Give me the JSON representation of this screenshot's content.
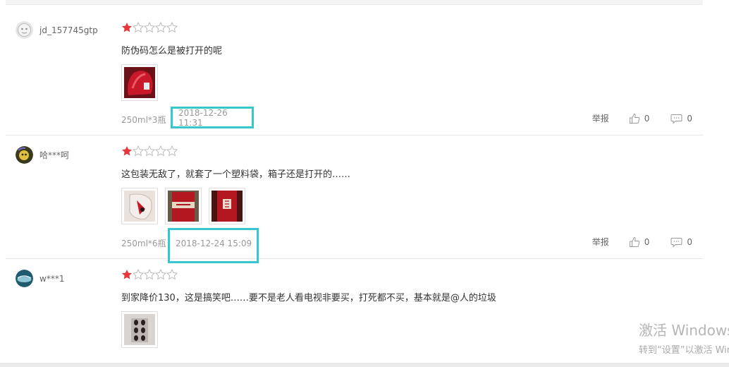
{
  "reviews": [
    {
      "username": "jd_157745gtp",
      "rating": 1,
      "max_rating": 5,
      "content": "防伪码怎么是被打开的呢",
      "image_count": 1,
      "spec": "250ml*3瓶",
      "date": "2018-12-26 11:31",
      "report_label": "举报",
      "likes": "0",
      "comments": "0"
    },
    {
      "username": "哈***呵",
      "rating": 1,
      "max_rating": 5,
      "content": "这包装无敌了，就套了一个塑料袋，箱子还是打开的……",
      "image_count": 3,
      "spec": "250ml*6瓶",
      "date": "2018-12-24 15:09",
      "report_label": "举报",
      "likes": "0",
      "comments": "0"
    },
    {
      "username": "w***1",
      "rating": 1,
      "max_rating": 5,
      "content": "到家降价130，这是搞笑吧……要不是老人看电视非要买，打死都不买，基本就是@人的垃圾",
      "image_count": 1
    }
  ],
  "watermark": {
    "line1": "激活 Windows",
    "line2": "转到“设置”以激活 Windows。"
  },
  "colors": {
    "star_filled": "#e4393c",
    "star_empty": "#bbbbbb",
    "highlight_box": "#35c7cd",
    "image_red": "#c8182a"
  }
}
